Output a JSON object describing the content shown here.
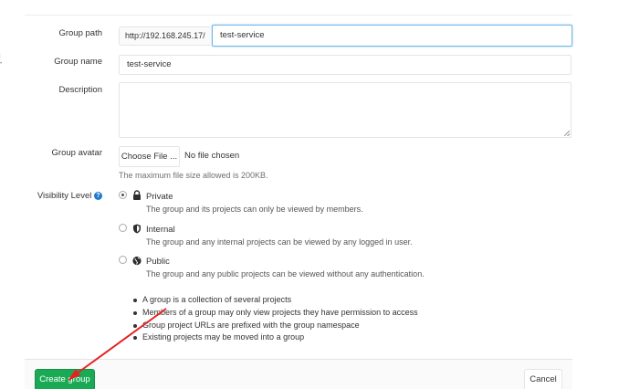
{
  "form": {
    "group_path": {
      "label": "Group path",
      "prefix": "http://192.168.245.17/",
      "value": "test-service"
    },
    "group_name": {
      "label": "Group name",
      "value": "test-service"
    },
    "description": {
      "label": "Description",
      "value": ""
    },
    "group_avatar": {
      "label": "Group avatar",
      "choose_label": "Choose File ...",
      "status": "No file chosen",
      "help": "The maximum file size allowed is 200KB."
    },
    "visibility": {
      "label": "Visibility Level",
      "help_icon": "?",
      "options": [
        {
          "title": "Private",
          "icon": "lock-icon",
          "checked": true,
          "description": "The group and its projects can only be viewed by members."
        },
        {
          "title": "Internal",
          "icon": "shield-icon",
          "checked": false,
          "description": "The group and any internal projects can be viewed by any logged in user."
        },
        {
          "title": "Public",
          "icon": "globe-icon",
          "checked": false,
          "description": "The group and any public projects can be viewed without any authentication."
        }
      ]
    },
    "info_bullets": [
      "A group is a collection of several projects",
      "Members of a group may only view projects they have permission to access",
      "Group project URLs are prefixed with the group namespace",
      "Existing projects may be moved into a group"
    ]
  },
  "actions": {
    "create_label": "Create group",
    "cancel_label": "Cancel"
  },
  "colors": {
    "primary_green": "#1aaa55",
    "focus_blue": "#73b6e6",
    "help_blue": "#1f78d1",
    "annotation_red": "#e52222"
  }
}
